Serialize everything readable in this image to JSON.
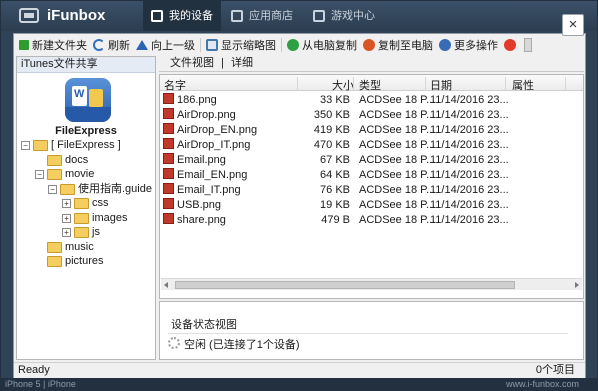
{
  "app": {
    "title": "iFunbox"
  },
  "tabs": [
    {
      "label": "我的设备",
      "active": true
    },
    {
      "label": "应用商店",
      "active": false
    },
    {
      "label": "游戏中心",
      "active": false
    }
  ],
  "dialog": {
    "close_label": "×"
  },
  "toolbar": {
    "new_folder": "新建文件夹",
    "refresh": "刷新",
    "up_one_level": "向上一级",
    "show_thumbnails": "显示缩略图",
    "copy_from_computer": "从电脑复制",
    "copy_to_computer": "复制至电脑",
    "more_actions": "更多操作"
  },
  "left": {
    "header": "iTunes文件共享",
    "app_name": "FileExpress",
    "tree": [
      {
        "label": "[ FileExpress ]",
        "toggle": "−",
        "depth": 0
      },
      {
        "label": "docs",
        "toggle": "",
        "depth": 1
      },
      {
        "label": "movie",
        "toggle": "−",
        "depth": 1
      },
      {
        "label": "使用指南.guide",
        "toggle": "−",
        "depth": 2
      },
      {
        "label": "css",
        "toggle": "+",
        "depth": 3
      },
      {
        "label": "images",
        "toggle": "+",
        "depth": 3
      },
      {
        "label": "js",
        "toggle": "+",
        "depth": 3
      },
      {
        "label": "music",
        "toggle": "",
        "depth": 1
      },
      {
        "label": "pictures",
        "toggle": "",
        "depth": 1
      }
    ]
  },
  "view_modes": {
    "file_view": "文件视图",
    "separator": "|",
    "details": "详细"
  },
  "columns": {
    "name": "名字",
    "size": "大小",
    "type": "类型",
    "date": "日期",
    "attributes": "属性"
  },
  "files": [
    {
      "name": "186.png",
      "size": "33 KB",
      "type": "ACDSee 18 P...",
      "date": "11/14/2016  23..."
    },
    {
      "name": "AirDrop.png",
      "size": "350 KB",
      "type": "ACDSee 18 P...",
      "date": "11/14/2016  23..."
    },
    {
      "name": "AirDrop_EN.png",
      "size": "419 KB",
      "type": "ACDSee 18 P...",
      "date": "11/14/2016  23..."
    },
    {
      "name": "AirDrop_IT.png",
      "size": "470 KB",
      "type": "ACDSee 18 P...",
      "date": "11/14/2016  23..."
    },
    {
      "name": "Email.png",
      "size": "67 KB",
      "type": "ACDSee 18 P...",
      "date": "11/14/2016  23..."
    },
    {
      "name": "Email_EN.png",
      "size": "64 KB",
      "type": "ACDSee 18 P...",
      "date": "11/14/2016  23..."
    },
    {
      "name": "Email_IT.png",
      "size": "76 KB",
      "type": "ACDSee 18 P...",
      "date": "11/14/2016  23..."
    },
    {
      "name": "USB.png",
      "size": "19 KB",
      "type": "ACDSee 18 P...",
      "date": "11/14/2016  23..."
    },
    {
      "name": "share.png",
      "size": "479 B",
      "type": "ACDSee 18 P...",
      "date": "11/14/2016  23..."
    }
  ],
  "device_status": {
    "title": "设备状态视图",
    "text": "空闲 (已连接了1个设备)"
  },
  "statusbar": {
    "ready": "Ready",
    "count": "0个项目"
  },
  "bottombar": {
    "device": "iPhone 5 | iPhone",
    "url": "www.i-funbox.com"
  }
}
